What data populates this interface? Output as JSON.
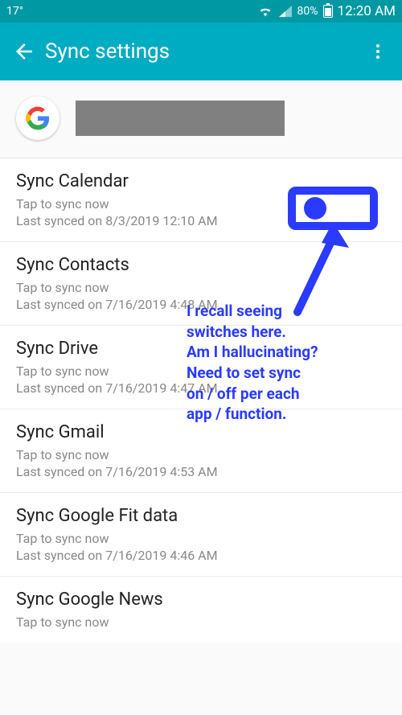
{
  "statusbar": {
    "temperature": "17°",
    "battery_pct": "80%",
    "time": "12:20 AM"
  },
  "appbar": {
    "title": "Sync settings"
  },
  "items": [
    {
      "title": "Sync Calendar",
      "tap": "Tap to sync now",
      "last": "Last synced on 8/3/2019  12:10 AM"
    },
    {
      "title": "Sync Contacts",
      "tap": "Tap to sync now",
      "last": "Last synced on 7/16/2019  4:48 AM"
    },
    {
      "title": "Sync Drive",
      "tap": "Tap to sync now",
      "last": "Last synced on 7/16/2019  4:47 AM"
    },
    {
      "title": "Sync Gmail",
      "tap": "Tap to sync now",
      "last": "Last synced on 7/16/2019  4:53 AM"
    },
    {
      "title": "Sync Google Fit data",
      "tap": "Tap to sync now",
      "last": "Last synced on 7/16/2019  4:46 AM"
    },
    {
      "title": "Sync Google News",
      "tap": "Tap to sync now",
      "last": ""
    }
  ],
  "annotation": {
    "line1": "I recall seeing",
    "line2": "switches here.",
    "line3": "Am I hallucinating?",
    "line4": "Need to set sync",
    "line5": "on / off per each",
    "line6": "app / function."
  },
  "colors": {
    "accent": "#00acc1",
    "annotation": "#2a3bff"
  }
}
